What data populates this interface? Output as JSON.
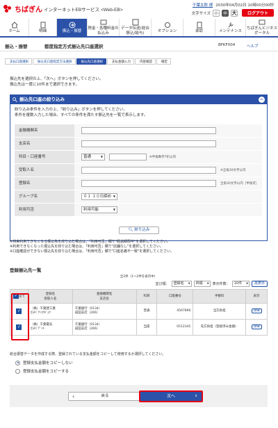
{
  "header": {
    "brand": "ちばぎん",
    "subtitle": "インターネットEBサービス <Web-EB>",
    "user": "千葉太郎 様",
    "login_time": "2030年04月02日 10時00分00秒",
    "font_size_label": "文字サイズ",
    "sizes": [
      "小",
      "中",
      "大"
    ],
    "logout": "ログアウト"
  },
  "nav": [
    {
      "label": "ホーム",
      "icon": "home-icon"
    },
    {
      "label": "明細",
      "icon": "document-icon"
    },
    {
      "label": "振込・振替",
      "icon": "transfer-icon"
    },
    {
      "label": "税金・各種料金の払込み",
      "icon": "tax-icon"
    },
    {
      "label": "データ伝送(総合振込/給与)",
      "icon": "data-icon"
    },
    {
      "label": "オプション",
      "icon": "option-icon"
    },
    {
      "label": "承認",
      "icon": "approve-icon"
    },
    {
      "label": "メンテナンス",
      "icon": "wrench-icon"
    },
    {
      "label": "ちばぎんビジネスポータル",
      "icon": "portal-icon"
    }
  ],
  "title": {
    "section": "振込・振替",
    "page": "都度指定方式振込先口座選択",
    "code": "BFKF004",
    "help": "ヘルプ"
  },
  "steps": [
    "支払口座選択",
    "振込先口座指定方法選択",
    "振込先口座選択",
    "支払金額入力",
    "内容確認",
    "確定"
  ],
  "intro": [
    "振込先を選択の上、「次へ」ボタンを押してください。",
    "振込先は一度に10件まで選択できます。"
  ],
  "filter": {
    "title": "振込先口座の絞り込み",
    "desc": [
      "絞り込み条件を入力の上、「絞り込み」ボタンを押してください。",
      "条件を複数入力した場合、すべての条件を満たす振込先を一覧で表示します。"
    ],
    "fields": {
      "bank": "金融機関名",
      "branch": "支店名",
      "account": "科目・口座番号",
      "payee": "受取人名",
      "reg": "登録名",
      "group": "グループ名",
      "usage": "利用可否"
    },
    "acct_type": "普通",
    "acct_hint": "※半角数字7桁以内",
    "payee_hint": "※全角30文字以内",
    "reg_hint": "全角30文字以内［半角可］",
    "group_val": "０１ １０日締め",
    "usage_val": "利用可能",
    "button": "絞り込み"
  },
  "notes": [
    "※将来利用できなくなる振込先を絞り込む場合は、「利用可否」欄で\"経過期限中\"を選択してください。",
    "※利用できなくなった振込先を絞り込む場合は、「利用可否」欄で\"店舗なし\"を選択してください。",
    "※口座確認ができない振込先を絞り込む場合は、「利用可否」欄で\"口座名義不一致\"を選択してください。"
  ],
  "list": {
    "heading": "登録振込先一覧",
    "count": "全2件（1〜2件を表示中）",
    "sort_label": "並び順：",
    "sort_val": "登録名",
    "order_val": "昇順",
    "per_page_label": "表示件数：",
    "per_page_val": "10件",
    "redisplay": "再表示",
    "headers": [
      "全て",
      "登録名\n受取人名",
      "金融機関名\n支店名",
      "科目",
      "口座番号",
      "手数料",
      "表示"
    ],
    "rows": [
      {
        "name": "（株）千葉建工業",
        "kana": "ｶ)ﾁﾊﾞｹﾝｺｳｷﾞｮｳ",
        "bank": "千葉銀行（0134）",
        "branch": "成田支店（266）",
        "type": "普通",
        "num": "4567890",
        "fee": "当方負担",
        "detail": "詳細"
      },
      {
        "name": "（株）千葉電気",
        "kana": "ｶ)ﾁﾊﾞﾃﾞﾝｷ",
        "bank": "千葉銀行（0134）",
        "branch": "成田支店（266）",
        "type": "当座",
        "num": "0512345",
        "fee": "先方負担（登録済み金額）",
        "detail": "詳細"
      }
    ]
  },
  "copy": {
    "desc": "総合振替データを作成する際、登録されている支払金額をコピーして使用するか選択してください。",
    "opt1": "登録支払金額をコピーしない",
    "opt2": "登録支払金額をコピーする"
  },
  "buttons": {
    "back": "戻る",
    "next": "次へ"
  }
}
